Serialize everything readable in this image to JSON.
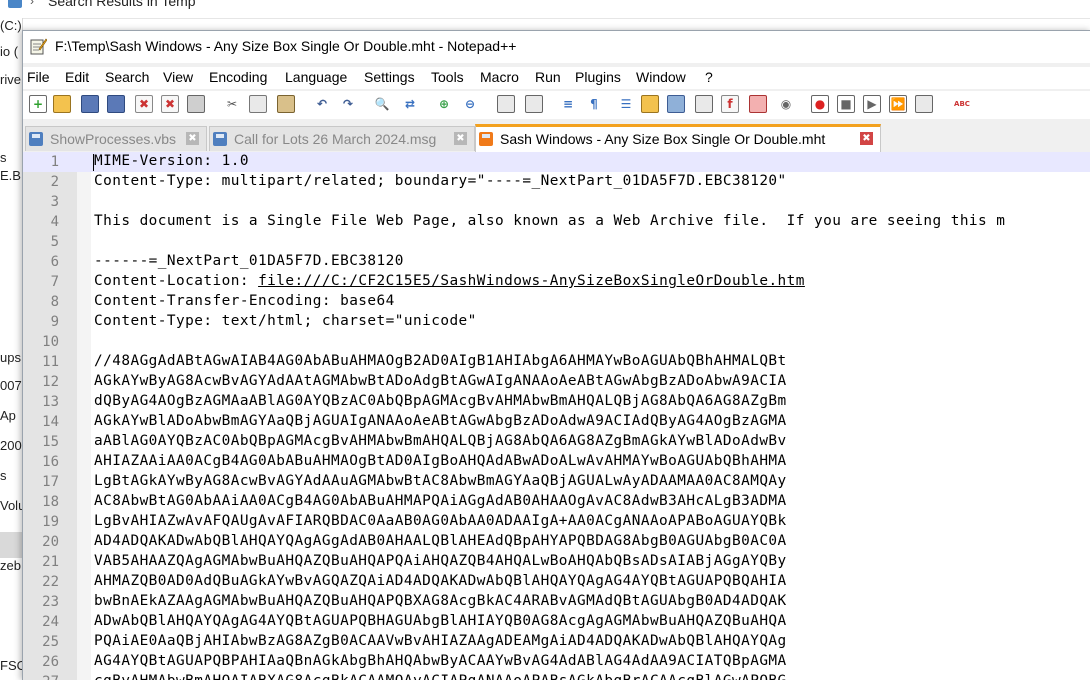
{
  "background_window": {
    "title": "Search Results in Temp",
    "left_fragments": [
      "(C:)",
      "io (",
      "rive",
      "s",
      "E.B",
      "ups",
      "007",
      "Ap",
      "200",
      "s",
      "Volu",
      "zeb",
      "FSO"
    ]
  },
  "window": {
    "title": "F:\\Temp\\Sash Windows - Any Size Box Single Or Double.mht - Notepad++"
  },
  "menu": [
    "File",
    "Edit",
    "Search",
    "View",
    "Encoding",
    "Language",
    "Settings",
    "Tools",
    "Macro",
    "Run",
    "Plugins",
    "Window",
    "?"
  ],
  "toolbar": {
    "icons": [
      "new-file-icon",
      "open-file-icon",
      "save-icon",
      "save-all-icon",
      "close-icon",
      "close-all-icon",
      "print-icon",
      "cut-icon",
      "copy-icon",
      "paste-icon",
      "undo-icon",
      "redo-icon",
      "find-icon",
      "replace-icon",
      "zoom-in-icon",
      "zoom-out-icon",
      "sync-vertical-icon",
      "sync-horizontal-icon",
      "word-wrap-icon",
      "show-all-chars-icon",
      "indent-guide-icon",
      "udl-icon",
      "doc-map-icon",
      "function-list-icon",
      "folder-as-workspace-icon",
      "doc-list-icon",
      "monitoring-icon",
      "record-macro-icon",
      "stop-macro-icon",
      "play-macro-icon",
      "run-macro-multiple-icon",
      "save-macro-icon",
      "spell-check-icon"
    ]
  },
  "tabs": [
    {
      "label": "ShowProcesses.vbs",
      "active": false
    },
    {
      "label": "Call for Lots 26 March 2024.msg",
      "active": false
    },
    {
      "label": "Sash Windows - Any Size Box Single Or Double.mht",
      "active": true
    }
  ],
  "editor": {
    "lines": [
      {
        "n": "1",
        "text": "MIME-Version: 1.0"
      },
      {
        "n": "2",
        "text": "Content-Type: multipart/related; boundary=\"----=_NextPart_01DA5F7D.EBC38120\""
      },
      {
        "n": "3",
        "text": ""
      },
      {
        "n": "4",
        "text": "This document is a Single File Web Page, also known as a Web Archive file.  If you are seeing this m"
      },
      {
        "n": "5",
        "text": ""
      },
      {
        "n": "6",
        "text": "------=_NextPart_01DA5F7D.EBC38120"
      },
      {
        "n": "7",
        "text": "Content-Location: ",
        "link": "file:///C:/CF2C15E5/SashWindows-AnySizeBoxSingleOrDouble.htm"
      },
      {
        "n": "8",
        "text": "Content-Transfer-Encoding: base64"
      },
      {
        "n": "9",
        "text": "Content-Type: text/html; charset=\"unicode\""
      },
      {
        "n": "10",
        "text": ""
      },
      {
        "n": "11",
        "text": "//48AGgAdABtAGwAIAB4AG0AbABuAHMAOgB2AD0AIgB1AHIAbgA6AHMAYwBoAGUAbQBhAHMALQBt"
      },
      {
        "n": "12",
        "text": "AGkAYwByAG8AcwBvAGYAdAAtAGMAbwBtADoAdgBtAGwAIgANAAoAeABtAGwAbgBzADoAbwA9ACIA"
      },
      {
        "n": "13",
        "text": "dQByAG4AOgBzAGMAaABlAG0AYQBzAC0AbQBpAGMAcgBvAHMAbwBmAHQALQBjAG8AbQA6AG8AZgBm"
      },
      {
        "n": "14",
        "text": "AGkAYwBlADoAbwBmAGYAaQBjAGUAIgANAAoAeABtAGwAbgBzADoAdwA9ACIAdQByAG4AOgBzAGMA"
      },
      {
        "n": "15",
        "text": "aABlAG0AYQBzAC0AbQBpAGMAcgBvAHMAbwBmAHQALQBjAG8AbQA6AG8AZgBmAGkAYwBlADoAdwBv"
      },
      {
        "n": "16",
        "text": "AHIAZAAiAA0ACgB4AG0AbABuAHMAOgBtAD0AIgBoAHQAdABwADoALwAvAHMAYwBoAGUAbQBhAHMA"
      },
      {
        "n": "17",
        "text": "LgBtAGkAYwByAG8AcwBvAGYAdAAuAGMAbwBtAC8AbwBmAGYAaQBjAGUALwAyADAAMAA0AC8AMQAy"
      },
      {
        "n": "18",
        "text": "AC8AbwBtAG0AbAAiAA0ACgB4AG0AbABuAHMAPQAiAGgAdAB0AHAAOgAvAC8AdwB3AHcALgB3ADMA"
      },
      {
        "n": "19",
        "text": "LgBvAHIAZwAvAFQAUgAvAFIARQBDAC0AaAB0AG0AbAA0ADAAIgA+AA0ACgANAAoAPABoAGUAYQBk"
      },
      {
        "n": "20",
        "text": "AD4ADQAKADwAbQBlAHQAYQAgAGgAdAB0AHAALQBlAHEAdQBpAHYAPQBDAG8AbgB0AGUAbgB0AC0A"
      },
      {
        "n": "21",
        "text": "VAB5AHAAZQAgAGMAbwBuAHQAZQBuAHQAPQAiAHQAZQB4AHQALwBoAHQAbQBsADsAIABjAGgAYQBy"
      },
      {
        "n": "22",
        "text": "AHMAZQB0AD0AdQBuAGkAYwBvAGQAZQAiAD4ADQAKADwAbQBlAHQAYQAgAG4AYQBtAGUAPQBQAHIA"
      },
      {
        "n": "23",
        "text": "bwBnAEkAZAAgAGMAbwBuAHQAZQBuAHQAPQBXAG8AcgBkAC4ARABvAGMAdQBtAGUAbgB0AD4ADQAK"
      },
      {
        "n": "24",
        "text": "ADwAbQBlAHQAYQAgAG4AYQBtAGUAPQBHAGUAbgBlAHIAYQB0AG8AcgAgAGMAbwBuAHQAZQBuAHQA"
      },
      {
        "n": "25",
        "text": "PQAiAE0AaQBjAHIAbwBzAG8AZgB0ACAAVwBvAHIAZAAgADEAMgAiAD4ADQAKADwAbQBlAHQAYQAg"
      },
      {
        "n": "26",
        "text": "AG4AYQBtAGUAPQBPAHIAaQBnAGkAbgBhAHQAbwByACAAYwBvAG4AdABlAG4AdAA9ACIATQBpAGMA"
      },
      {
        "n": "27",
        "text": "cgBvAHMAbwBmAHQAIABXAG8AcgBkACAAMQAyACIAPgANAAoAPABsAGkAbgBrACAAcgBlAGwAPQBG"
      }
    ]
  }
}
